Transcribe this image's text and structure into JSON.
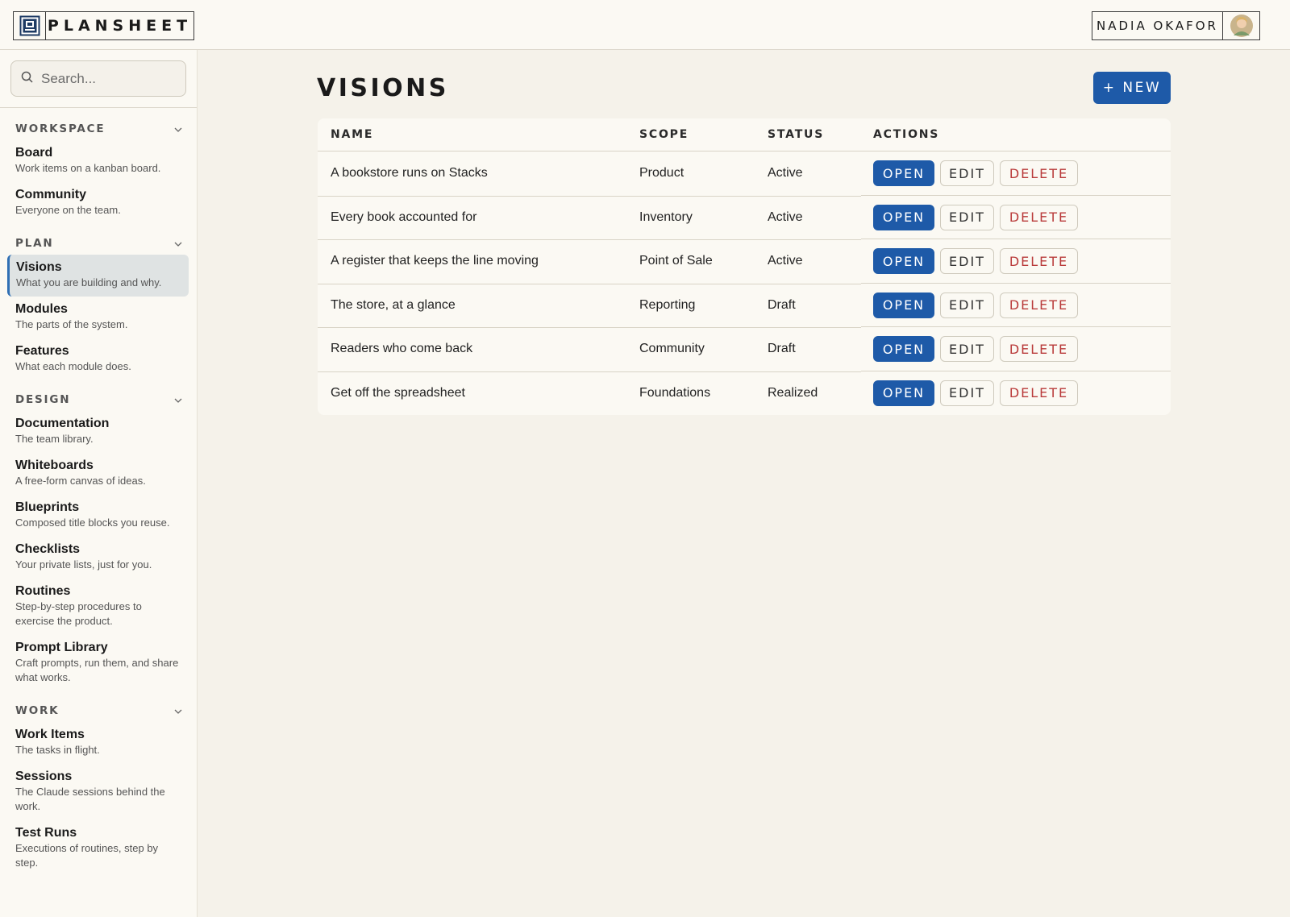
{
  "app": {
    "name": "PLANSHEET"
  },
  "user": {
    "name": "NADIA OKAFOR"
  },
  "search": {
    "placeholder": "Search..."
  },
  "sidebar": {
    "sections": [
      {
        "title": "WORKSPACE",
        "items": [
          {
            "label": "Board",
            "desc": "Work items on a kanban board."
          },
          {
            "label": "Community",
            "desc": "Everyone on the team."
          }
        ]
      },
      {
        "title": "PLAN",
        "items": [
          {
            "label": "Visions",
            "desc": "What you are building and why."
          },
          {
            "label": "Modules",
            "desc": "The parts of the system."
          },
          {
            "label": "Features",
            "desc": "What each module does."
          }
        ]
      },
      {
        "title": "DESIGN",
        "items": [
          {
            "label": "Documentation",
            "desc": "The team library."
          },
          {
            "label": "Whiteboards",
            "desc": "A free-form canvas of ideas."
          },
          {
            "label": "Blueprints",
            "desc": "Composed title blocks you reuse."
          },
          {
            "label": "Checklists",
            "desc": "Your private lists, just for you."
          },
          {
            "label": "Routines",
            "desc": "Step-by-step procedures to exercise the product."
          },
          {
            "label": "Prompt Library",
            "desc": "Craft prompts, run them, and share what works."
          }
        ]
      },
      {
        "title": "WORK",
        "items": [
          {
            "label": "Work Items",
            "desc": "The tasks in flight."
          },
          {
            "label": "Sessions",
            "desc": "The Claude sessions behind the work."
          },
          {
            "label": "Test Runs",
            "desc": "Executions of routines, step by step."
          }
        ]
      }
    ]
  },
  "main": {
    "title": "VISIONS",
    "new_label": "+ NEW",
    "columns": [
      "NAME",
      "SCOPE",
      "STATUS",
      "ACTIONS"
    ],
    "actions": {
      "open": "OPEN",
      "edit": "EDIT",
      "delete": "DELETE"
    },
    "rows": [
      {
        "name": "A bookstore runs on Stacks",
        "scope": "Product",
        "status": "Active"
      },
      {
        "name": "Every book accounted for",
        "scope": "Inventory",
        "status": "Active"
      },
      {
        "name": "A register that keeps the line moving",
        "scope": "Point of Sale",
        "status": "Active"
      },
      {
        "name": "The store, at a glance",
        "scope": "Reporting",
        "status": "Draft"
      },
      {
        "name": "Readers who come back",
        "scope": "Community",
        "status": "Draft"
      },
      {
        "name": "Get off the spreadsheet",
        "scope": "Foundations",
        "status": "Realized"
      }
    ]
  },
  "colors": {
    "accent": "#1e5aa8",
    "danger": "#b93a3a",
    "background": "#f5f2ea"
  }
}
